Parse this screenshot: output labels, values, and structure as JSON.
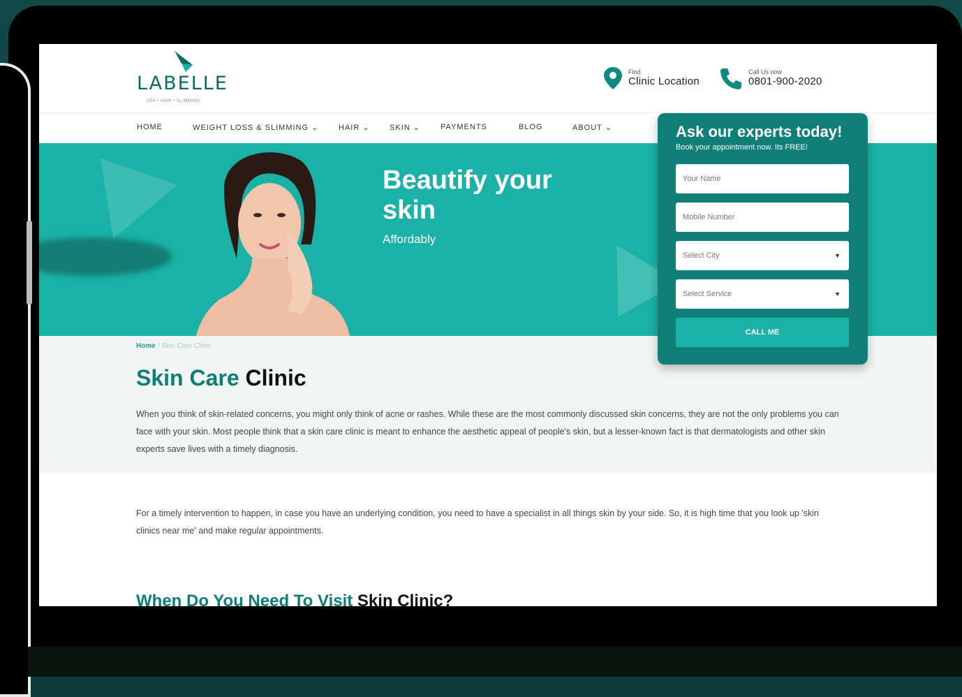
{
  "brand": {
    "name": "LABELLE",
    "tagline": "SPA • HAIR • SLIMMING"
  },
  "header": {
    "location": {
      "small": "Find",
      "big": "Clinic Location"
    },
    "phone": {
      "small": "Call Us now",
      "big": "0801-900-2020"
    }
  },
  "nav": {
    "items": [
      {
        "label": "HOME"
      },
      {
        "label": "WEIGHT LOSS & SLIMMING ⌄"
      },
      {
        "label": "HAIR ⌄"
      },
      {
        "label": "SKIN ⌄"
      },
      {
        "label": "PAYMENTS"
      },
      {
        "label": "BLOG"
      },
      {
        "label": "ABOUT ⌄"
      }
    ]
  },
  "hero": {
    "title": "Beautify your skin",
    "subtitle": "Affordably"
  },
  "form": {
    "title": "Ask our experts today!",
    "subtitle": "Book your appointment now. Its FREE!",
    "name_placeholder": "Your Name",
    "mobile_placeholder": "Mobile Number",
    "city_placeholder": "Select City",
    "service_placeholder": "Select Service",
    "submit_label": "CALL ME"
  },
  "breadcrumb": {
    "home": "Home",
    "sep": " / ",
    "current": "Skin Care Clinic"
  },
  "page": {
    "title_accent": "Skin Care",
    "title_dark": " Clinic",
    "para1": "When you think of skin-related concerns, you might only think of acne or rashes. While these are the most commonly discussed skin concerns, they are not the only problems you can face with your skin. Most people think that a skin care clinic is meant to enhance the aesthetic appeal of people's skin, but a lesser-known fact is that dermatologists and other skin experts save lives with a timely diagnosis.",
    "para2": "For a timely intervention to happen, in case you have an underlying condition, you need to have a specialist in all things skin by your side. So, it is high time that you look up 'skin clinics near me' and make regular appointments.",
    "section_accent": "When Do You Need To Visit",
    "section_dark": " Skin Clinic?"
  },
  "colors": {
    "teal": "#1ab2a6",
    "dark_teal": "#0f7f78",
    "accent_text": "#0d7f77"
  }
}
